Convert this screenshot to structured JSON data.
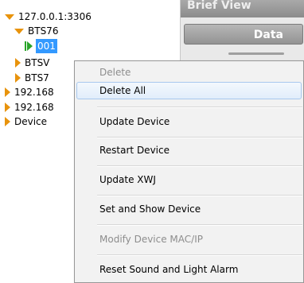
{
  "tree": {
    "nodes": [
      {
        "label": "127.0.0.1:3306",
        "icon": "expanded-triangle-icon"
      },
      {
        "label": "BTS76",
        "icon": "expanded-triangle-icon"
      },
      {
        "label": "001",
        "icon": "green-play-icon",
        "selected": true
      },
      {
        "label": "BTSV",
        "icon": "collapsed-triangle-icon"
      },
      {
        "label": "BTS7",
        "icon": "collapsed-triangle-icon"
      },
      {
        "label": "192.168",
        "icon": "collapsed-triangle-icon"
      },
      {
        "label": "192.168",
        "icon": "collapsed-triangle-icon"
      },
      {
        "label": "Device",
        "icon": "collapsed-triangle-icon"
      }
    ]
  },
  "right_panel": {
    "header": "Brief View",
    "data_button": "Data"
  },
  "context_menu": {
    "items": [
      {
        "label": "Delete",
        "enabled": false
      },
      {
        "label": "Delete All",
        "enabled": true,
        "hover": true
      },
      {
        "label": "Update Device",
        "enabled": true
      },
      {
        "label": "Restart Device",
        "enabled": true
      },
      {
        "label": "Update XWJ",
        "enabled": true
      },
      {
        "label": "Set and Show Device",
        "enabled": true
      },
      {
        "label": "Modify Device MAC/IP",
        "enabled": false
      },
      {
        "label": "Reset Sound and Light Alarm",
        "enabled": true
      }
    ]
  },
  "colors": {
    "tree_triangle": "#e8930c",
    "green_play": "#2aa52a",
    "selection": "#3399ff",
    "menu_hover_border": "#a8c8ee"
  }
}
